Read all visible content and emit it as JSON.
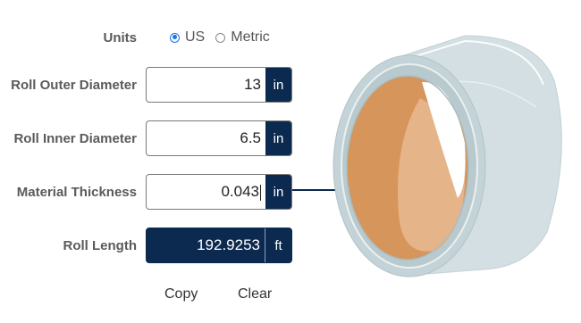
{
  "units": {
    "label": "Units",
    "options": [
      "US",
      "Metric"
    ],
    "selected": "US"
  },
  "fields": [
    {
      "label": "Roll Outer Diameter",
      "value": "13",
      "unit": "in"
    },
    {
      "label": "Roll Inner Diameter",
      "value": "6.5",
      "unit": "in"
    },
    {
      "label": "Material Thickness",
      "value": "0.043",
      "unit": "in"
    }
  ],
  "result": {
    "label": "Roll Length",
    "value": "192.9253",
    "unit": "ft"
  },
  "actions": {
    "copy": "Copy",
    "clear": "Clear"
  },
  "colors": {
    "unit_bg": "#0c2a50",
    "accent": "#1a73e8",
    "roll_outer": "#cfdcdf",
    "roll_core": "#d6955a"
  }
}
